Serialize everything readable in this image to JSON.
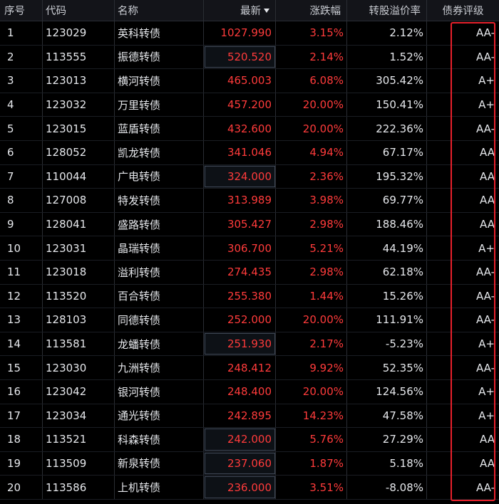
{
  "headers": {
    "idx": "序号",
    "code": "代码",
    "name": "名称",
    "price": "最新",
    "change": "涨跌幅",
    "premium": "转股溢价率",
    "rating": "债券评级"
  },
  "rows": [
    {
      "idx": "1",
      "code": "123029",
      "name": "英科转债",
      "price": "1027.990",
      "change": "3.15%",
      "premium": "2.12%",
      "rating": "AA-"
    },
    {
      "idx": "2",
      "code": "113555",
      "name": "振德转债",
      "price": "520.520",
      "change": "2.14%",
      "premium": "1.52%",
      "rating": "AA-"
    },
    {
      "idx": "3",
      "code": "123013",
      "name": "横河转债",
      "price": "465.003",
      "change": "6.08%",
      "premium": "305.42%",
      "rating": "A+"
    },
    {
      "idx": "4",
      "code": "123032",
      "name": "万里转债",
      "price": "457.200",
      "change": "20.00%",
      "premium": "150.41%",
      "rating": "A+"
    },
    {
      "idx": "5",
      "code": "123015",
      "name": "蓝盾转债",
      "price": "432.600",
      "change": "20.00%",
      "premium": "222.36%",
      "rating": "AA-"
    },
    {
      "idx": "6",
      "code": "128052",
      "name": "凯龙转债",
      "price": "341.046",
      "change": "4.94%",
      "premium": "67.17%",
      "rating": "AA"
    },
    {
      "idx": "7",
      "code": "110044",
      "name": "广电转债",
      "price": "324.000",
      "change": "2.36%",
      "premium": "195.32%",
      "rating": "AA"
    },
    {
      "idx": "8",
      "code": "127008",
      "name": "特发转债",
      "price": "313.989",
      "change": "3.98%",
      "premium": "69.77%",
      "rating": "AA"
    },
    {
      "idx": "9",
      "code": "128041",
      "name": "盛路转债",
      "price": "305.427",
      "change": "2.98%",
      "premium": "188.46%",
      "rating": "AA"
    },
    {
      "idx": "10",
      "code": "123031",
      "name": "晶瑞转债",
      "price": "306.700",
      "change": "5.21%",
      "premium": "44.19%",
      "rating": "A+"
    },
    {
      "idx": "11",
      "code": "123018",
      "name": "溢利转债",
      "price": "274.435",
      "change": "2.98%",
      "premium": "62.18%",
      "rating": "AA-"
    },
    {
      "idx": "12",
      "code": "113520",
      "name": "百合转债",
      "price": "255.380",
      "change": "1.44%",
      "premium": "15.26%",
      "rating": "AA-"
    },
    {
      "idx": "13",
      "code": "128103",
      "name": "同德转债",
      "price": "252.000",
      "change": "20.00%",
      "premium": "111.91%",
      "rating": "AA-"
    },
    {
      "idx": "14",
      "code": "113581",
      "name": "龙蟠转债",
      "price": "251.930",
      "change": "2.17%",
      "premium": "-5.23%",
      "rating": "A+"
    },
    {
      "idx": "15",
      "code": "123030",
      "name": "九洲转债",
      "price": "248.412",
      "change": "9.92%",
      "premium": "52.35%",
      "rating": "AA-"
    },
    {
      "idx": "16",
      "code": "123042",
      "name": "银河转债",
      "price": "248.400",
      "change": "20.00%",
      "premium": "124.56%",
      "rating": "A+"
    },
    {
      "idx": "17",
      "code": "123034",
      "name": "通光转债",
      "price": "242.895",
      "change": "14.23%",
      "premium": "47.58%",
      "rating": "A+"
    },
    {
      "idx": "18",
      "code": "113521",
      "name": "科森转债",
      "price": "242.000",
      "change": "5.76%",
      "premium": "27.29%",
      "rating": "AA"
    },
    {
      "idx": "19",
      "code": "113509",
      "name": "新泉转债",
      "price": "237.060",
      "change": "1.87%",
      "premium": "5.18%",
      "rating": "AA"
    },
    {
      "idx": "20",
      "code": "113586",
      "name": "上机转债",
      "price": "236.000",
      "change": "3.51%",
      "premium": "-8.08%",
      "rating": "AA-"
    }
  ],
  "colors": {
    "up": "#ff3b3b",
    "text": "#e6e8ec",
    "highlight": "#e8202b"
  }
}
